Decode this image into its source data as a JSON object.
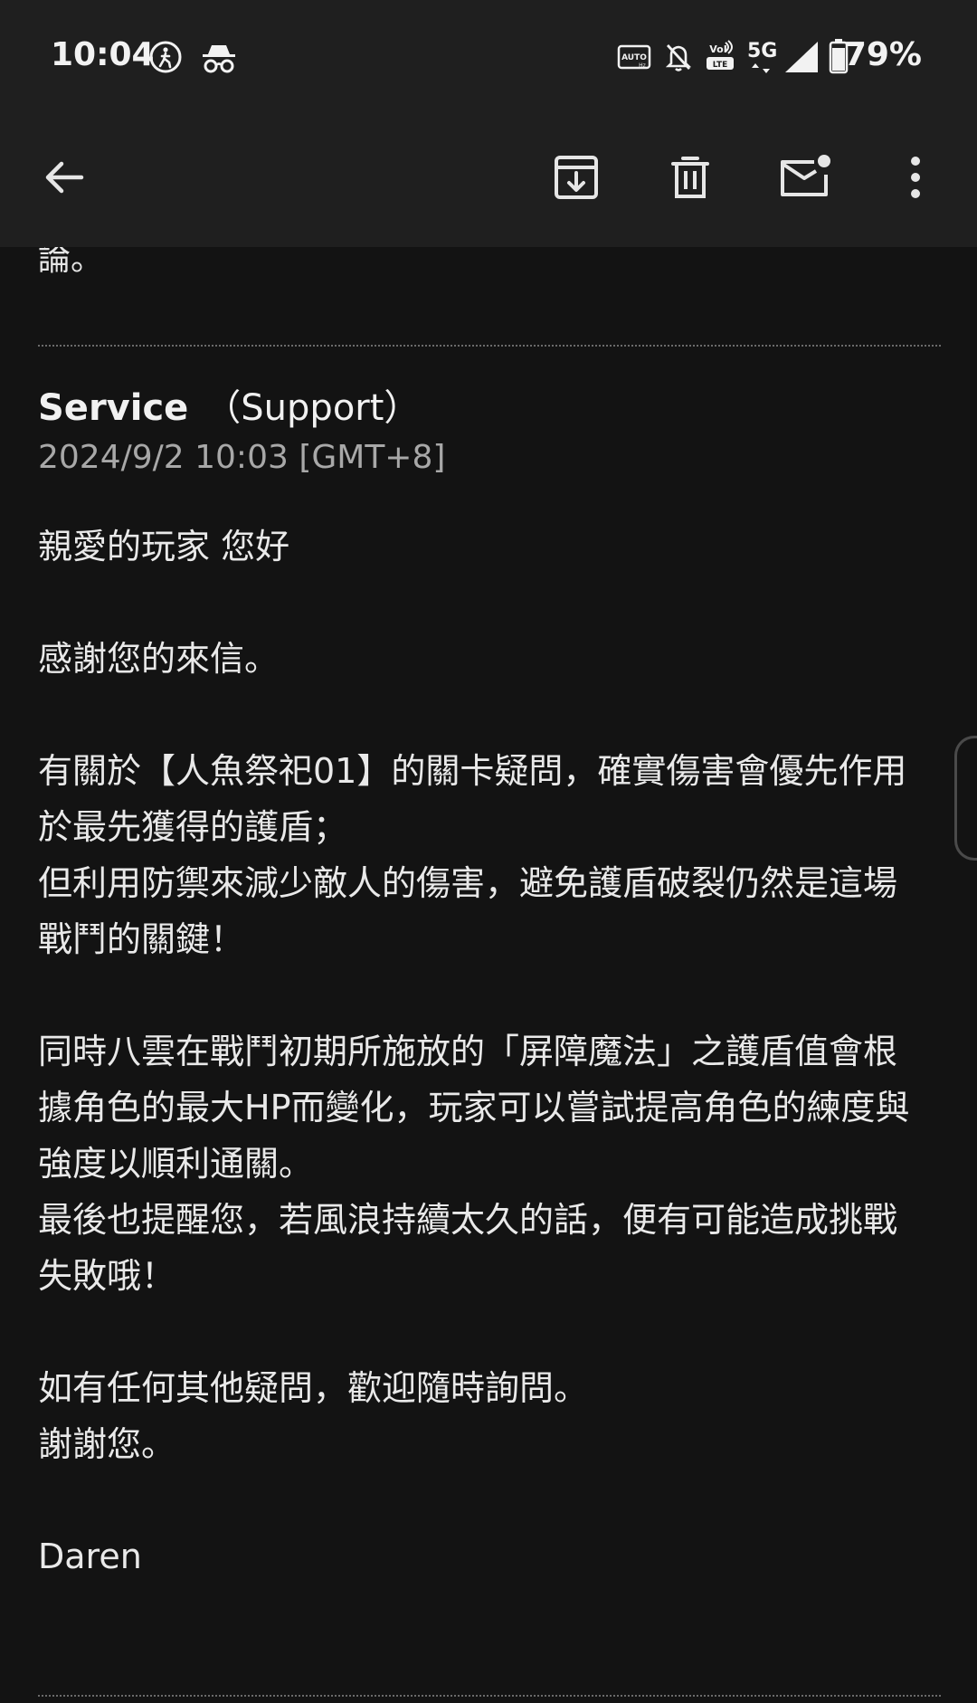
{
  "status": {
    "time": "10:04",
    "network": "5G",
    "battery_pct": "79%"
  },
  "toolbar": {
    "back_icon": "arrow-left-icon",
    "archive_icon": "archive-icon",
    "delete_icon": "trash-icon",
    "mark_unread_icon": "mark-unread-icon",
    "more_icon": "more-vertical-icon"
  },
  "email": {
    "previous_tail": "論。",
    "sender_name": "Service",
    "sender_role": "（Support）",
    "date": "2024/9/2 10:03 [GMT+8]",
    "body": {
      "greeting": "親愛的玩家 您好",
      "thanks": "感謝您的來信。",
      "para1_line1": "有關於【人魚祭祀01】的關卡疑問，確實傷害會優先作用",
      "para1_line2": "於最先獲得的護盾；",
      "para1_line3": "但利用防禦來減少敵人的傷害，避免護盾破裂仍然是這場",
      "para1_line4": "戰鬥的關鍵！",
      "para2_line1": "同時八雲在戰鬥初期所施放的「屏障魔法」之護盾值會根",
      "para2_line2": "據角色的最大HP而變化，玩家可以嘗試提高角色的練度與",
      "para2_line3": "強度以順利通關。",
      "para2_line4": "最後也提醒您，若風浪持續太久的話，便有可能造成挑戰",
      "para2_line5": "失敗哦！",
      "closing1": "如有任何其他疑問，歡迎隨時詢問。",
      "closing2": "謝謝您。",
      "signature": "Daren"
    }
  },
  "colors": {
    "background": "#131313",
    "bar": "#1f1f1f",
    "text": "#e9e9e9",
    "muted": "#a8a8a8"
  }
}
